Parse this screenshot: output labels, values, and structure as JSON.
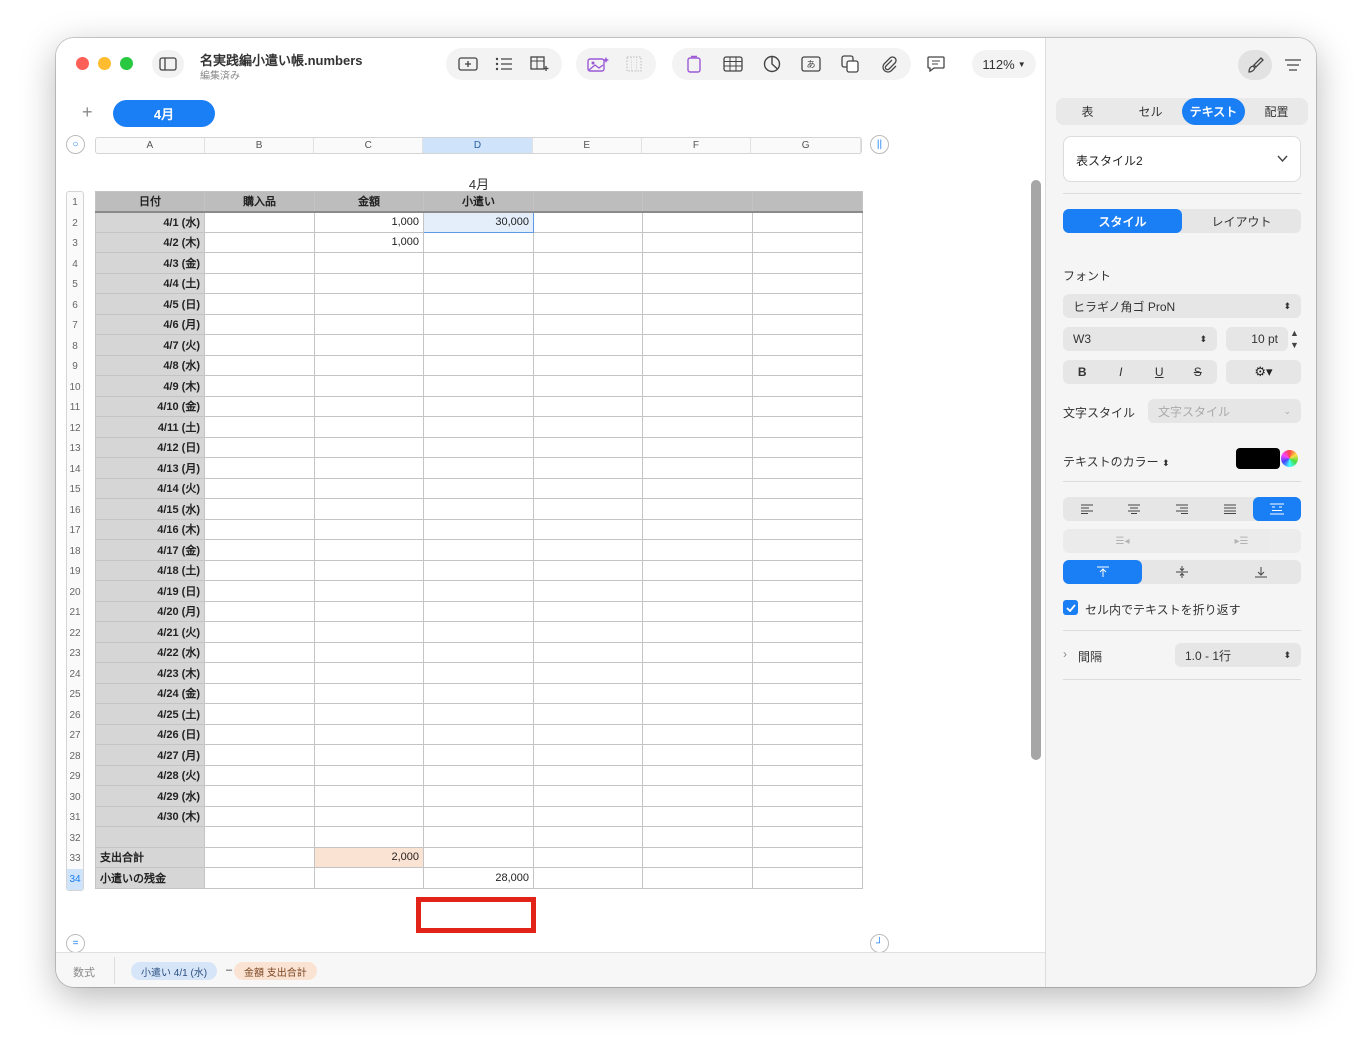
{
  "window": {
    "title": "名実践編小遣い帳.numbers",
    "subtitle": "編集済み",
    "zoom": "112%"
  },
  "sheet_tabs": {
    "add": "+",
    "active": "4月"
  },
  "table": {
    "title": "4月",
    "columns": [
      "A",
      "B",
      "C",
      "D",
      "E",
      "F",
      "G"
    ],
    "selected_column": "D",
    "row_numbers": [
      "1",
      "2",
      "3",
      "4",
      "5",
      "6",
      "7",
      "8",
      "9",
      "10",
      "11",
      "12",
      "13",
      "14",
      "15",
      "16",
      "17",
      "18",
      "19",
      "20",
      "21",
      "22",
      "23",
      "24",
      "25",
      "26",
      "27",
      "28",
      "29",
      "30",
      "31",
      "32",
      "33",
      "34"
    ],
    "headers": [
      "日付",
      "購入品",
      "金額",
      "小遣い",
      "",
      "",
      ""
    ],
    "rows": [
      [
        "4/1 (水)",
        "",
        "1,000",
        "30,000",
        "",
        "",
        ""
      ],
      [
        "4/2 (木)",
        "",
        "1,000",
        "",
        "",
        "",
        ""
      ],
      [
        "4/3 (金)",
        "",
        "",
        "",
        "",
        "",
        ""
      ],
      [
        "4/4 (土)",
        "",
        "",
        "",
        "",
        "",
        ""
      ],
      [
        "4/5 (日)",
        "",
        "",
        "",
        "",
        "",
        ""
      ],
      [
        "4/6 (月)",
        "",
        "",
        "",
        "",
        "",
        ""
      ],
      [
        "4/7 (火)",
        "",
        "",
        "",
        "",
        "",
        ""
      ],
      [
        "4/8 (水)",
        "",
        "",
        "",
        "",
        "",
        ""
      ],
      [
        "4/9 (木)",
        "",
        "",
        "",
        "",
        "",
        ""
      ],
      [
        "4/10 (金)",
        "",
        "",
        "",
        "",
        "",
        ""
      ],
      [
        "4/11 (土)",
        "",
        "",
        "",
        "",
        "",
        ""
      ],
      [
        "4/12 (日)",
        "",
        "",
        "",
        "",
        "",
        ""
      ],
      [
        "4/13 (月)",
        "",
        "",
        "",
        "",
        "",
        ""
      ],
      [
        "4/14 (火)",
        "",
        "",
        "",
        "",
        "",
        ""
      ],
      [
        "4/15 (水)",
        "",
        "",
        "",
        "",
        "",
        ""
      ],
      [
        "4/16 (木)",
        "",
        "",
        "",
        "",
        "",
        ""
      ],
      [
        "4/17 (金)",
        "",
        "",
        "",
        "",
        "",
        ""
      ],
      [
        "4/18 (土)",
        "",
        "",
        "",
        "",
        "",
        ""
      ],
      [
        "4/19 (日)",
        "",
        "",
        "",
        "",
        "",
        ""
      ],
      [
        "4/20 (月)",
        "",
        "",
        "",
        "",
        "",
        ""
      ],
      [
        "4/21 (火)",
        "",
        "",
        "",
        "",
        "",
        ""
      ],
      [
        "4/22 (水)",
        "",
        "",
        "",
        "",
        "",
        ""
      ],
      [
        "4/23 (木)",
        "",
        "",
        "",
        "",
        "",
        ""
      ],
      [
        "4/24 (金)",
        "",
        "",
        "",
        "",
        "",
        ""
      ],
      [
        "4/25 (土)",
        "",
        "",
        "",
        "",
        "",
        ""
      ],
      [
        "4/26 (日)",
        "",
        "",
        "",
        "",
        "",
        ""
      ],
      [
        "4/27 (月)",
        "",
        "",
        "",
        "",
        "",
        ""
      ],
      [
        "4/28 (火)",
        "",
        "",
        "",
        "",
        "",
        ""
      ],
      [
        "4/29 (水)",
        "",
        "",
        "",
        "",
        "",
        ""
      ],
      [
        "4/30 (木)",
        "",
        "",
        "",
        "",
        "",
        ""
      ],
      [
        "",
        "",
        "",
        "",
        "",
        "",
        ""
      ]
    ],
    "footer": [
      [
        "支出合計",
        "",
        "2,000",
        "",
        "",
        "",
        ""
      ],
      [
        "小遣いの残金",
        "",
        "",
        "28,000",
        "",
        "",
        ""
      ]
    ]
  },
  "formula_bar": {
    "label": "数式",
    "token1": "小遣い 4/1 (水)",
    "operator": "–",
    "token2": "金額 支出合計"
  },
  "inspector": {
    "tabs": [
      "表",
      "セル",
      "テキスト",
      "配置"
    ],
    "active_tab": "テキスト",
    "style_name": "表スタイル2",
    "sub_tabs": [
      "スタイル",
      "レイアウト"
    ],
    "active_sub_tab": "スタイル",
    "font_label": "フォント",
    "font_family": "ヒラギノ角ゴ ProN",
    "font_weight": "W3",
    "font_size": "10 pt",
    "style_buttons": [
      "B",
      "I",
      "U",
      "S"
    ],
    "char_style_label": "文字スタイル",
    "char_style_placeholder": "文字スタイル",
    "text_color_label": "テキストのカラー",
    "wrap_label": "セル内でテキストを折り返す",
    "spacing_label": "間隔",
    "spacing_value": "1.0 - 1行"
  },
  "colors": {
    "accent": "#1a7ef5",
    "highlight": "#e2231a",
    "orange_token": "#fbe3d3",
    "blue_token": "#d7e5f8"
  }
}
